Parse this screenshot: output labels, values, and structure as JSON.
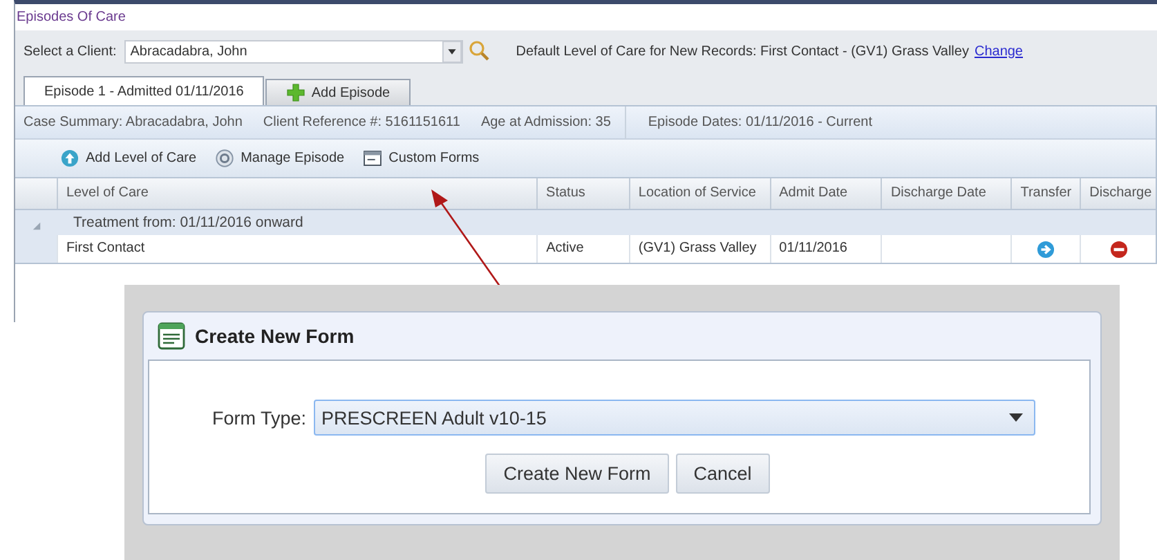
{
  "window": {
    "title": "Episodes Of Care"
  },
  "client_select": {
    "label": "Select a Client:",
    "value": "Abracadabra, John"
  },
  "default_level": {
    "text": "Default Level of Care for New Records: First Contact - (GV1) Grass Valley",
    "link": "Change"
  },
  "tabs": [
    {
      "label": "Episode 1 - Admitted 01/11/2016",
      "selected": true,
      "kind": "tab"
    },
    {
      "label": "Add Episode",
      "selected": false,
      "kind": "add"
    }
  ],
  "summary": [
    "Case Summary: Abracadabra, John",
    "Client Reference #: 5161151611",
    "Age at Admission: 35",
    "Episode Dates: 01/11/2016 - Current"
  ],
  "toolbar": [
    {
      "label": "Add Level of Care",
      "kind": "add"
    },
    {
      "label": "Manage Episode",
      "kind": "manage"
    },
    {
      "label": "Custom Forms",
      "kind": "forms"
    }
  ],
  "table": {
    "columns": [
      "Level of Care",
      "Status",
      "Location of Service",
      "Admit Date",
      "Discharge Date",
      "Transfer",
      "Discharge"
    ],
    "groups": [
      {
        "label": "Treatment from: 01/11/2016 onward",
        "expanded": true,
        "rows": [
          {
            "level": "First Contact",
            "status": "Active",
            "location": "(GV1) Grass Valley",
            "admit_date": "01/11/2016"
          }
        ]
      }
    ]
  },
  "dialog": {
    "title": "Create New Form",
    "form_type": {
      "label": "Form Type:",
      "value": "PRESCREEN Adult v10-15"
    },
    "buttons": [
      "Create New Form",
      "Cancel"
    ]
  }
}
